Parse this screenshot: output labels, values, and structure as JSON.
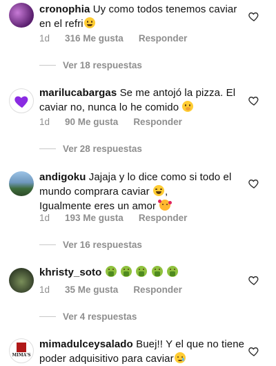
{
  "comments": [
    {
      "username": "cronophia",
      "text": "Uy como todos tenemos caviar en el refri",
      "time": "1d",
      "likes": "316 Me gusta",
      "reply_label": "Responder",
      "view_replies": "Ver 18 respuestas",
      "avatar_color": "#6b2e7e",
      "emojis": [
        "grinning-sweat-emoji"
      ]
    },
    {
      "username": "marilucabargas",
      "text": "Se me antojó la pizza. El caviar no, nunca lo he comido",
      "time": "1d",
      "likes": "90 Me gusta",
      "reply_label": "Responder",
      "view_replies": "Ver 28 respuestas",
      "avatar_color": "#7b2fbe",
      "emojis": [
        "hand-over-mouth-emoji"
      ]
    },
    {
      "username": "andigoku",
      "text": "Jajaja y lo dice como si todo el mundo comprara caviar",
      "text2": "Igualmente eres un amor",
      "time": "1d",
      "likes": "193 Me gusta",
      "reply_label": "Responder",
      "view_replies": "Ver 16 respuestas",
      "avatar_color": "#4a7ba6",
      "emojis": [
        "laughing-emoji",
        "smiling-hearts-emoji"
      ]
    },
    {
      "username": "khristy_soto",
      "text": "",
      "time": "1d",
      "likes": "35 Me gusta",
      "reply_label": "Responder",
      "view_replies": "Ver 4 respuestas",
      "avatar_color": "#3f4a35",
      "emojis": [
        "vomiting-emoji",
        "vomiting-emoji",
        "vomiting-emoji",
        "vomiting-emoji",
        "vomiting-emoji"
      ]
    },
    {
      "username": "mimadulceysalado",
      "text": "Buej!! Y el que no tiene poder adquisitivo para caviar",
      "avatar_color": "#b01818",
      "avatar_text": "MIMA'S",
      "emojis": [
        "crying-emoji"
      ]
    }
  ],
  "colors": {
    "meta": "#8e8e8e",
    "line": "#c7c7c7",
    "accent_purple": "#8a2be2"
  }
}
